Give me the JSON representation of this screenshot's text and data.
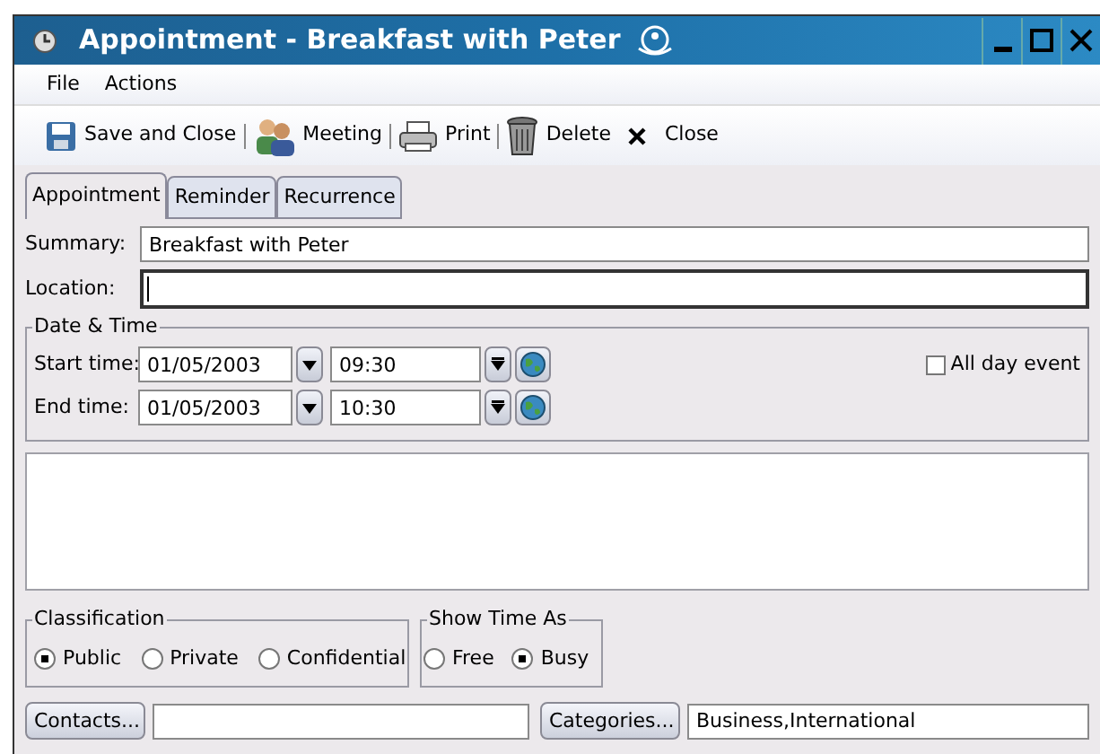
{
  "window": {
    "title": "Appointment - Breakfast with Peter"
  },
  "menu": [
    "File",
    "Actions"
  ],
  "toolbar": [
    {
      "kind": "save",
      "label": "Save and Close"
    },
    {
      "kind": "meeting",
      "label": "Meeting"
    },
    {
      "kind": "print",
      "label": "Print"
    },
    {
      "kind": "delete",
      "label": "Delete"
    },
    {
      "kind": "close",
      "label": "Close"
    }
  ],
  "tabs": [
    {
      "label": "Appointment",
      "selected": true
    },
    {
      "label": "Reminder",
      "selected": false
    },
    {
      "label": "Recurrence",
      "selected": false
    }
  ],
  "summary": {
    "label": "Summary:",
    "value": "Breakfast with Peter"
  },
  "location": {
    "label": "Location:",
    "focused": true
  },
  "date_time": {
    "title": "Date & Time",
    "rows": [
      {
        "label": "Start time:",
        "date": "01/05/2003",
        "time": "09:30"
      },
      {
        "label": "End time:",
        "date": "01/05/2003",
        "time": "10:30"
      }
    ],
    "all_day": {
      "label": "All day event",
      "checked": false
    }
  },
  "classification": {
    "title": "Classification",
    "options": [
      {
        "label": "Public",
        "selected": true
      },
      {
        "label": "Private",
        "selected": false
      },
      {
        "label": "Confidential",
        "selected": false
      }
    ]
  },
  "show_time_as": {
    "title": "Show Time As",
    "options": [
      {
        "label": "Free",
        "selected": false
      },
      {
        "label": "Busy",
        "selected": true
      }
    ]
  },
  "contacts": {
    "button": "Contacts..."
  },
  "categories": {
    "button": "Categories...",
    "value": "Business,International"
  }
}
